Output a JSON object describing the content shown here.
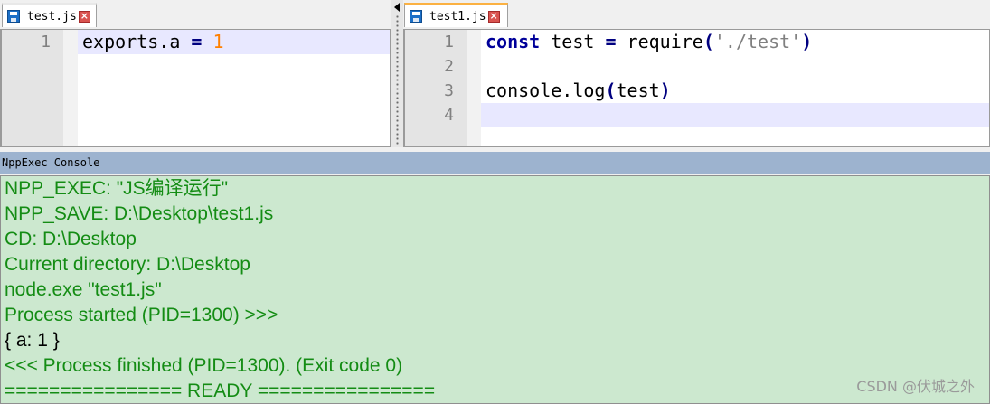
{
  "left_editor": {
    "tab_title": "test.js",
    "lines": [
      {
        "num": "1",
        "tokens": [
          {
            "t": "exports.a ",
            "c": ""
          },
          {
            "t": "=",
            "c": "op"
          },
          {
            "t": " ",
            "c": ""
          },
          {
            "t": "1",
            "c": "num"
          }
        ]
      }
    ],
    "current_line": 1
  },
  "right_editor": {
    "tab_title": "test1.js",
    "lines": [
      {
        "num": "1",
        "tokens": [
          {
            "t": "const",
            "c": "kw"
          },
          {
            "t": " test ",
            "c": ""
          },
          {
            "t": "=",
            "c": "op"
          },
          {
            "t": " require",
            "c": ""
          },
          {
            "t": "(",
            "c": "op"
          },
          {
            "t": "'./test'",
            "c": "str"
          },
          {
            "t": ")",
            "c": "op"
          }
        ]
      },
      {
        "num": "2",
        "tokens": []
      },
      {
        "num": "3",
        "tokens": [
          {
            "t": "console.log",
            "c": ""
          },
          {
            "t": "(",
            "c": "op"
          },
          {
            "t": "test",
            "c": ""
          },
          {
            "t": ")",
            "c": "op"
          }
        ]
      },
      {
        "num": "4",
        "tokens": []
      }
    ],
    "current_line": 4
  },
  "console": {
    "title": "NppExec Console",
    "lines": [
      {
        "text": "NPP_EXEC: \"JS编译运行\"",
        "kind": "info"
      },
      {
        "text": "NPP_SAVE: D:\\Desktop\\test1.js",
        "kind": "info"
      },
      {
        "text": "CD: D:\\Desktop",
        "kind": "info"
      },
      {
        "text": "Current directory: D:\\Desktop",
        "kind": "info"
      },
      {
        "text": "node.exe \"test1.js\"",
        "kind": "info"
      },
      {
        "text": "Process started (PID=1300) >>>",
        "kind": "info"
      },
      {
        "text": "{ a: 1 }",
        "kind": "output"
      },
      {
        "text": "<<< Process finished (PID=1300). (Exit code 0)",
        "kind": "info"
      },
      {
        "text": "================ READY ================",
        "kind": "info"
      }
    ]
  },
  "watermark": "CSDN @伏城之外",
  "icons": {
    "tab_icon": "save-disk-icon",
    "tab_close": "close-icon",
    "close_glyph": "×"
  },
  "colors": {
    "keyword": "#00009a",
    "number": "#ff8000",
    "string": "#808080",
    "console_text": "#148c14",
    "console_bg": "#cce8cf",
    "active_tab_accent": "#fbb142"
  }
}
